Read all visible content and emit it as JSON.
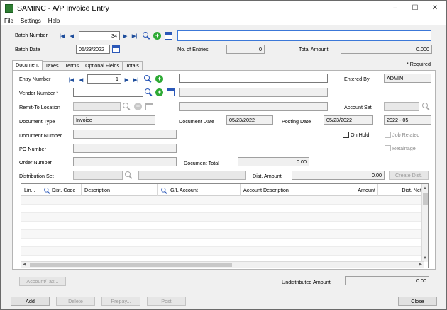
{
  "window": {
    "title": "SAMINC - A/P Invoice Entry",
    "min_label": "–",
    "max_label": "☐",
    "close_label": "✕"
  },
  "menu": [
    "File",
    "Settings",
    "Help"
  ],
  "batch": {
    "number_label": "Batch Number",
    "number_value": "34",
    "description_value": "",
    "date_label": "Batch Date",
    "date_value": "05/23/2022",
    "entries_label": "No. of Entries",
    "entries_value": "0",
    "total_label": "Total Amount",
    "total_value": "0.000"
  },
  "required_note": "* Required",
  "tabs": [
    "Document",
    "Taxes",
    "Terms",
    "Optional Fields",
    "Totals"
  ],
  "doc": {
    "entry_number_label": "Entry Number",
    "entry_number_value": "1",
    "entry_desc_value": "",
    "entered_by_label": "Entered By",
    "entered_by_value": "ADMIN",
    "vendor_label": "Vendor Number *",
    "vendor_value": "",
    "vendor_name_value": "",
    "remit_label": "Remit-To Location",
    "remit_value": "",
    "remit_desc_value": "",
    "account_set_label": "Account Set",
    "account_set_value": "",
    "doc_type_label": "Document Type",
    "doc_type_value": "Invoice",
    "doc_date_label": "Document Date",
    "doc_date_value": "05/23/2022",
    "posting_date_label": "Posting Date",
    "posting_date_value": "05/23/2022",
    "period_value": "2022 - 05",
    "doc_number_label": "Document Number",
    "doc_number_value": "",
    "on_hold_label": "On Hold",
    "job_related_label": "Job Related",
    "retainage_label": "Retainage",
    "po_label": "PO Number",
    "po_value": "",
    "order_label": "Order Number",
    "order_value": "",
    "doc_total_label": "Document Total",
    "doc_total_value": "0.00",
    "dist_set_label": "Distribution Set",
    "dist_set_value": "",
    "dist_set_desc_value": "",
    "dist_amount_label": "Dist. Amount",
    "dist_amount_value": "0.00",
    "create_dist_label": "Create Dist."
  },
  "grid": {
    "columns": [
      "Lin...",
      "Dist. Code",
      "Description",
      "G/L Account",
      "Account Description",
      "Amount",
      "Dist. Net"
    ]
  },
  "bottom": {
    "account_tax_label": "Account/Tax...",
    "undistributed_label": "Undistributed Amount",
    "undistributed_value": "0.00"
  },
  "buttons": {
    "add": "Add",
    "delete": "Delete",
    "prepay": "Prepay...",
    "post": "Post",
    "close": "Close"
  }
}
